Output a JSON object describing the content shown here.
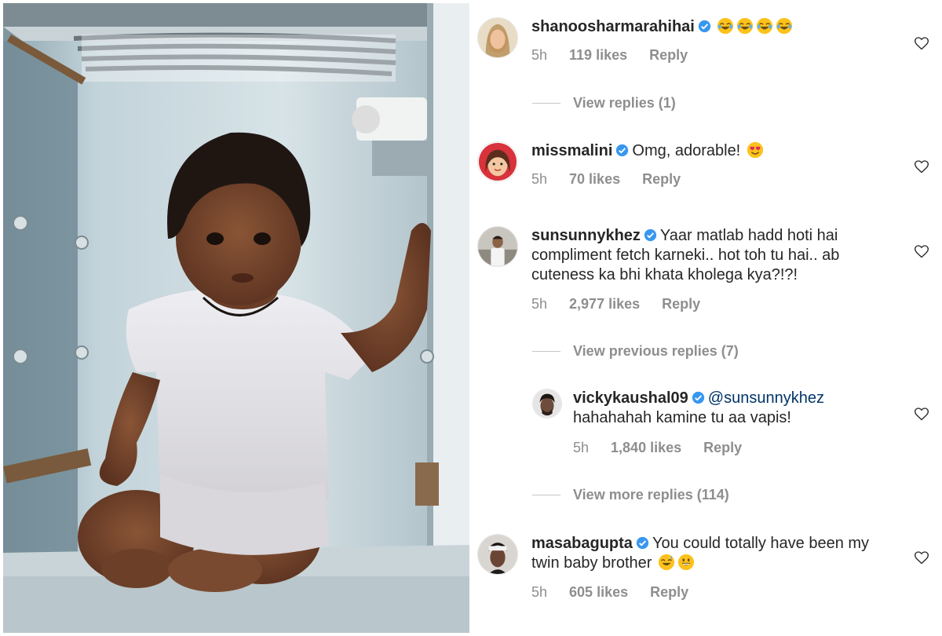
{
  "comments": [
    {
      "username": "shanoosharmarahihai",
      "verified": true,
      "text": "",
      "emoji": [
        "joy-emoji",
        "joy-emoji",
        "joy-emoji",
        "joy-emoji"
      ],
      "time": "5h",
      "likes": "119 likes",
      "reply": "Reply",
      "view_replies": "View replies (1)"
    },
    {
      "username": "missmalini",
      "verified": true,
      "text": "Omg, adorable!",
      "emoji": [
        "heart-eyes-emoji"
      ],
      "time": "5h",
      "likes": "70 likes",
      "reply": "Reply"
    },
    {
      "username": "sunsunnykhez",
      "verified": true,
      "text": "Yaar matlab hadd hoti hai compliment fetch karneki.. hot toh tu hai.. ab cuteness ka bhi khata kholega kya?!?!",
      "time": "5h",
      "likes": "2,977 likes",
      "reply": "Reply",
      "view_previous": "View previous replies (7)",
      "reply_thread": {
        "username": "vickykaushal09",
        "verified": true,
        "mention": "@sunsunnykhez",
        "text": "hahahahah kamine tu aa vapis!",
        "time": "5h",
        "likes": "1,840 likes",
        "reply": "Reply"
      },
      "view_more": "View more replies (114)"
    },
    {
      "username": "masabagupta",
      "verified": true,
      "text": "You could totally have been my twin baby brother",
      "emoji": [
        "sweat-smile-emoji",
        "grin-emoji"
      ],
      "time": "5h",
      "likes": "605 likes",
      "reply": "Reply"
    }
  ],
  "colors": {
    "text": "#262626",
    "muted": "#8e8e8e",
    "verified": "#3897f0",
    "mention": "#003569"
  },
  "icons": {
    "like": "heart-outline-icon",
    "verified": "verified-badge-icon"
  }
}
